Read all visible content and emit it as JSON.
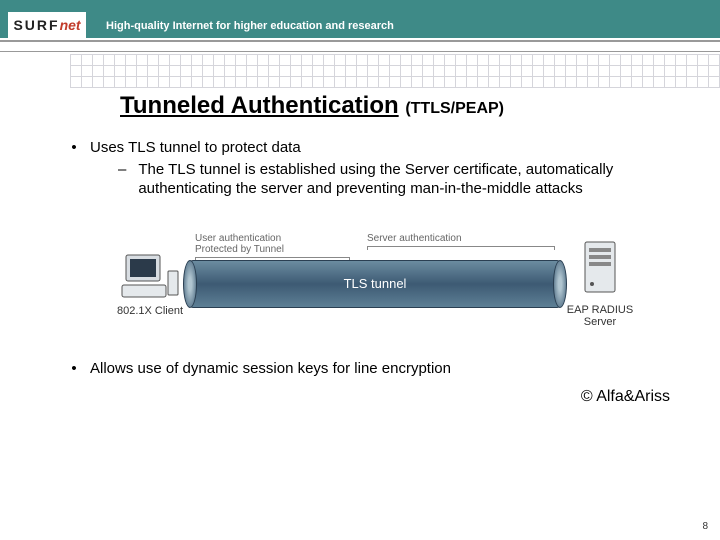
{
  "header": {
    "logo_main": "SURF",
    "logo_highlight": "net",
    "tagline": "High-quality Internet for higher education and research"
  },
  "title": {
    "main": "Tunneled Authentication",
    "sub": "(TTLS/PEAP)"
  },
  "bullets": {
    "b1": "Uses TLS tunnel to protect data",
    "b1_sub": "The TLS tunnel is established using the Server certificate, automatically authenticating the server and preventing man-in-the-middle attacks",
    "b2": "Allows use of dynamic session keys for line encryption"
  },
  "diagram": {
    "user_auth_l1": "User authentication",
    "user_auth_l2": "Protected by Tunnel",
    "server_auth": "Server authentication",
    "tunnel_label": "TLS tunnel",
    "client_label": "802.1X Client",
    "server_label": "EAP RADIUS Server"
  },
  "footer": {
    "copyright": "© Alfa&Ariss",
    "page": "8"
  }
}
